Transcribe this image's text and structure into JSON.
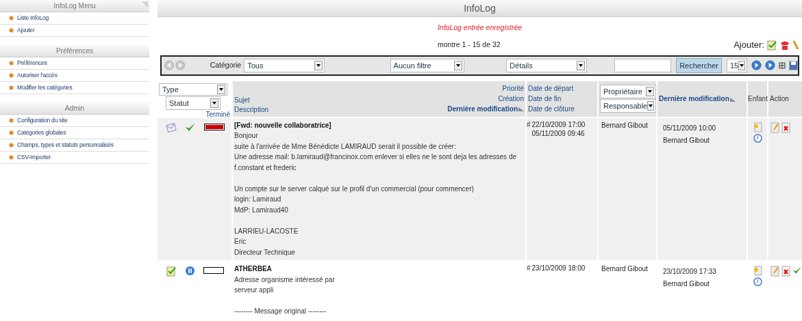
{
  "sidebar": {
    "sections": [
      {
        "title": "InfoLog Menu",
        "items": [
          "Liste InfoLog",
          "Ajouter"
        ]
      },
      {
        "title": "Préférences",
        "items": [
          "Préférences",
          "Autoriser l'accès",
          "Modifier les catégories"
        ]
      },
      {
        "title": "Admin",
        "items": [
          "Configuration du site",
          "Catégories globales",
          "Champs, types et statuts personnalisés",
          "CSV-Importer"
        ]
      }
    ]
  },
  "main": {
    "title": "InfoLog",
    "message": "InfoLog entrée enregistrée",
    "count": "montre 1 - 15 de 32",
    "add_label": "Ajouter:",
    "toolbar": {
      "category_label": "Catégorie",
      "category": "Tous",
      "filter": "Aucun filtre",
      "details": "Détails",
      "search_button": "Rechercher",
      "per_page": "15"
    },
    "table": {
      "header": {
        "type": "Type",
        "status": "Statut",
        "done": "Terminé",
        "subject": "Sujet",
        "description": "Description",
        "priority": "Priorité",
        "created": "Création",
        "modified": "Dernière modification",
        "start": "Date de départ",
        "end": "Date de fin",
        "closed": "Date de clôture",
        "owner": "Propriétaire",
        "responsible": "Responsable",
        "last_modified": "Dernière modification",
        "child": "Enfant",
        "action": "Action"
      },
      "rows": [
        {
          "type": {
            "kind": "note"
          },
          "status": {
            "kind": "done"
          },
          "level": 1,
          "subject": "[Fwd: nouvelle collaboratrice]",
          "description": [
            [
              "Bonjour",
              "suite à l'arrivée de Mme Bénédicte LAMIRAUD serait il possible de créer:",
              "Une adresse mail: b.lamiraud@francinox.com enlever si elles ne le sont deja les adresses de",
              "f.constant et frederic"
            ],
            [
              "Un compte sur le server calqué sur le profil d'un commercial (pour commencer)",
              "login: Lamiraud",
              "MdP: Lamiraud40"
            ],
            [
              "LARRIEU-LACOSTE",
              "Eric",
              "Directeur Technique"
            ]
          ],
          "priority": "#",
          "dates": [
            "22/10/2009 17:00",
            "05/11/2009 09:46"
          ],
          "owner": "Bernard Gibout",
          "modified": "05/11/2009 10:00",
          "modified_by": "Bernard Gibout",
          "actions": [
            {
              "kind": "edit"
            },
            {
              "kind": "delete"
            }
          ]
        },
        {
          "type": {
            "kind": "task"
          },
          "status": {
            "kind": "paused"
          },
          "level": 0,
          "subject": "ATHERBEA",
          "description": [
            [
              "Adresse organisme intéressé par",
              "serveur appli"
            ],
            [
              "-------- Message original --------"
            ]
          ],
          "priority": "#",
          "dates": [
            "23/10/2009 18:00"
          ],
          "owner": "Bernard Gibout",
          "modified": "23/10/2009 17:33",
          "modified_by": "Bernard Gibout",
          "actions": [
            {
              "kind": "edit"
            },
            {
              "kind": "delete"
            },
            {
              "kind": "close"
            }
          ]
        }
      ]
    }
  }
}
